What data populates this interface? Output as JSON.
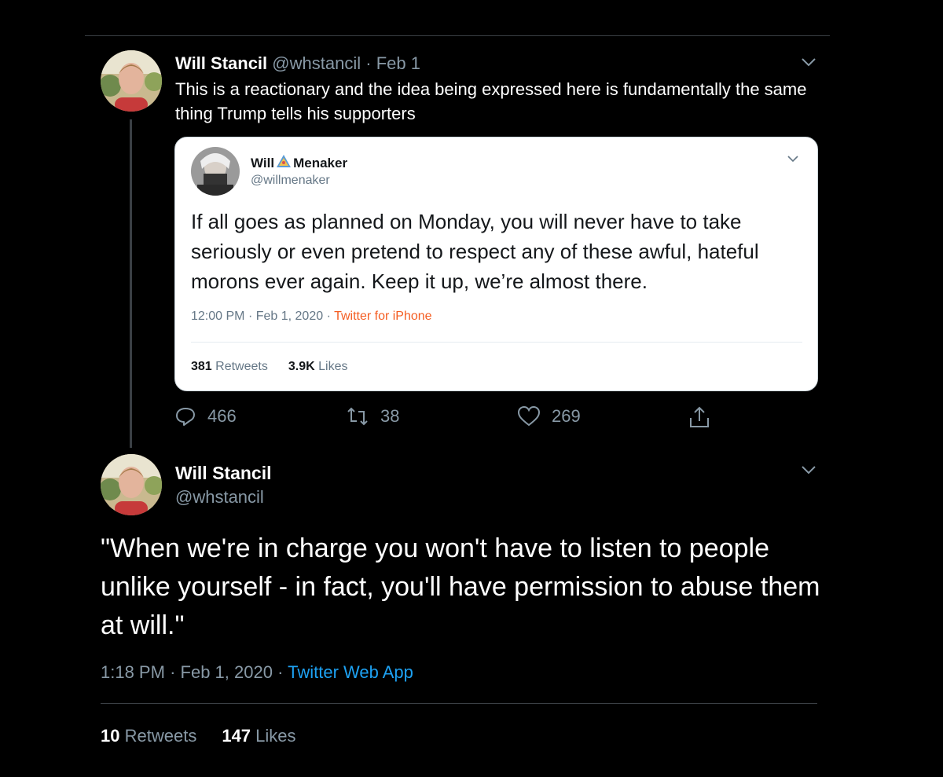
{
  "colors": {
    "background": "#000000",
    "muted": "#8899a6",
    "link_blue": "#1da1f2",
    "source_orange": "#f45d22",
    "divider": "#3a3f44"
  },
  "tweet1": {
    "name": "Will Stancil",
    "handle": "@whstancil",
    "date": "Feb 1",
    "text": "This is a reactionary and the idea being expressed here is fundamentally the same thing Trump tells his supporters",
    "quoted": {
      "name_first": "Will",
      "name_last": "Menaker",
      "handle": "@willmenaker",
      "text": "If all goes as planned on Monday, you will never have to take seriously or even pretend to respect any of these awful, hateful morons ever again. Keep it up, we’re almost there.",
      "time": "12:00 PM",
      "date": "Feb 1, 2020",
      "source": "Twitter for iPhone",
      "retweets_count": "381",
      "retweets_label": "Retweets",
      "likes_count": "3.9K",
      "likes_label": "Likes"
    },
    "replies": "466",
    "retweets": "38",
    "likes": "269"
  },
  "tweet2": {
    "name": "Will Stancil",
    "handle": "@whstancil",
    "text": "\"When we're in charge you won't have to listen to people unlike yourself - in fact, you'll have permission to abuse them at will.\"",
    "time": "1:18 PM",
    "date": "Feb 1, 2020",
    "source": "Twitter Web App",
    "retweets_count": "10",
    "retweets_label": "Retweets",
    "likes_count": "147",
    "likes_label": "Likes"
  },
  "icons": {
    "reply": "reply-icon",
    "retweet": "retweet-icon",
    "like": "heart-icon",
    "share": "share-icon",
    "menu": "chevron-down-icon"
  }
}
